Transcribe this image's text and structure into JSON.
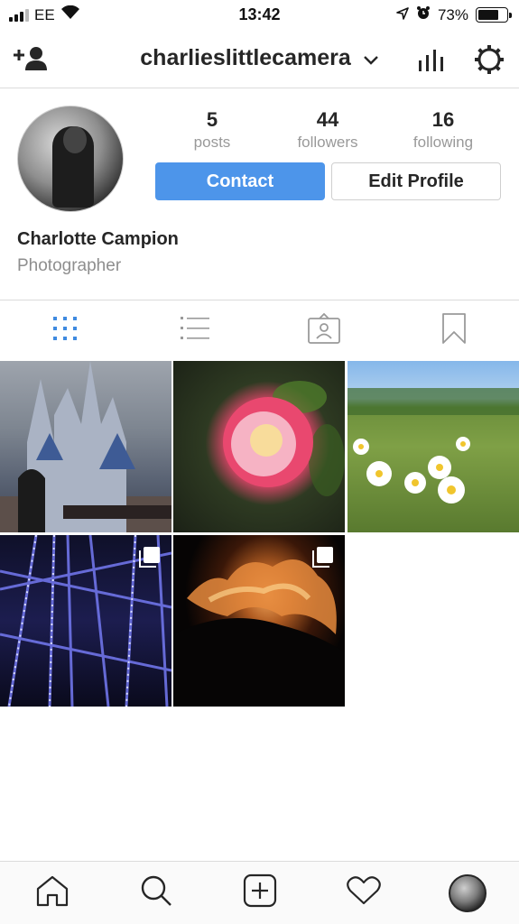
{
  "status_bar": {
    "carrier": "EE",
    "time": "13:42",
    "battery": "73%",
    "battery_level": 0.73,
    "icons": [
      "signal-icon",
      "wifi-icon",
      "location-icon",
      "alarm-icon",
      "battery-icon"
    ]
  },
  "top_nav": {
    "username": "charlieslittlecamera",
    "icons": [
      "add-user-icon",
      "chevron-down-icon",
      "insights-icon",
      "gear-icon"
    ]
  },
  "profile": {
    "stats": [
      {
        "value": "5",
        "label": "posts"
      },
      {
        "value": "44",
        "label": "followers"
      },
      {
        "value": "16",
        "label": "following"
      }
    ],
    "contact_label": "Contact",
    "edit_label": "Edit Profile",
    "full_name": "Charlotte Campion",
    "bio": "Photographer"
  },
  "tabs": [
    "grid-icon",
    "list-icon",
    "tagged-icon",
    "saved-icon"
  ],
  "posts": [
    {
      "subject": "castle",
      "multi": false
    },
    {
      "subject": "rose",
      "multi": false
    },
    {
      "subject": "daisies",
      "multi": false
    },
    {
      "subject": "ferris-wheel",
      "multi": true
    },
    {
      "subject": "fire",
      "multi": true
    }
  ],
  "bottom_nav": [
    "home-icon",
    "search-icon",
    "new-post-icon",
    "heart-icon",
    "profile-avatar"
  ],
  "colors": {
    "accent": "#4d95ea",
    "text": "#262626",
    "muted": "#8e8e8e",
    "divider": "#dbdbdb"
  }
}
